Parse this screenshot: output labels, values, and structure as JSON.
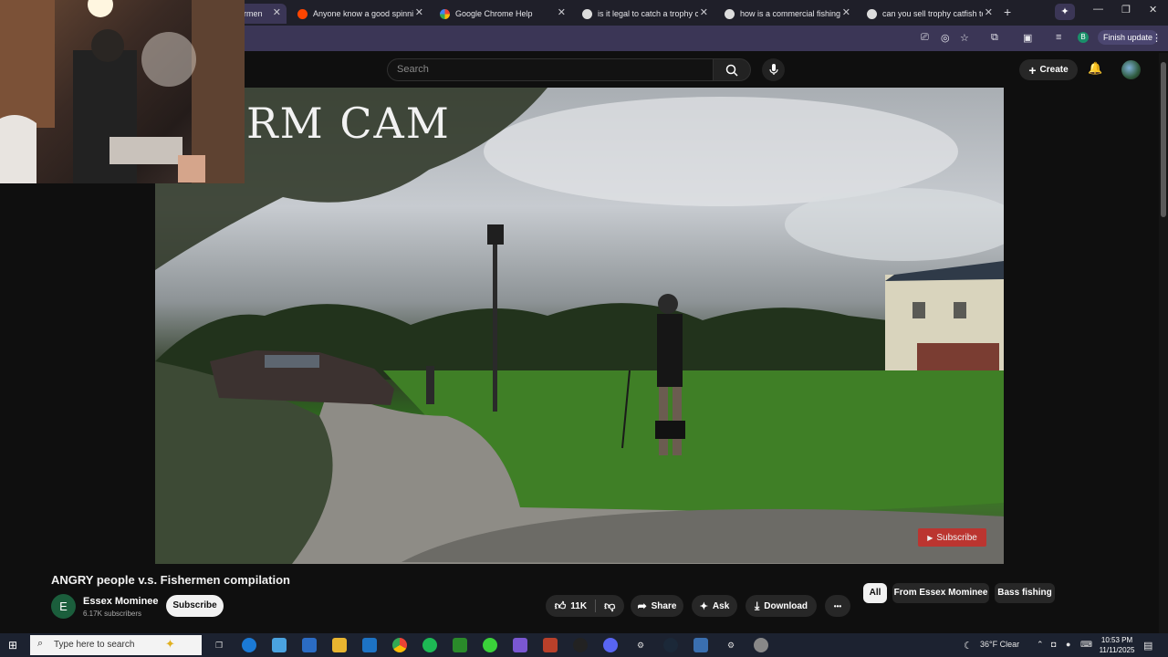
{
  "browser": {
    "tabs": [
      {
        "label": "ermen",
        "favicon": "youtube-favicon",
        "active": true
      },
      {
        "label": "Anyone know a good spinning",
        "favicon": "reddit-favicon"
      },
      {
        "label": "Google Chrome Help",
        "favicon": "google-favicon"
      },
      {
        "label": "is it legal to catch a trophy cat",
        "favicon": "google-favicon"
      },
      {
        "label": "how is a commercial fishing lic",
        "favicon": "google-favicon"
      },
      {
        "label": "can you sell trophy catfish to p",
        "favicon": "google-favicon"
      }
    ],
    "new_tab": "+",
    "finish_update": "Finish update",
    "profile_initial": "B"
  },
  "youtube": {
    "search_placeholder": "Search",
    "create_label": "Create"
  },
  "video": {
    "overlay_text": "RM CAM",
    "watermark_subscribe": "Subscribe",
    "title": "ANGRY people v.s. Fishermen compilation",
    "channel": {
      "name": "Essex Mominee",
      "subscribers": "6.17K subscribers",
      "initial": "E"
    },
    "subscribe_label": "Subscribe",
    "actions": {
      "likes": "11K",
      "share": "Share",
      "ask": "Ask",
      "download": "Download",
      "more": "•••"
    }
  },
  "chips": [
    "All",
    "From Essex Mominee",
    "Bass fishing"
  ],
  "taskbar": {
    "search_placeholder": "Type here to search",
    "weather": "36°F  Clear",
    "time": "10:53 PM",
    "date": "11/11/2025"
  }
}
